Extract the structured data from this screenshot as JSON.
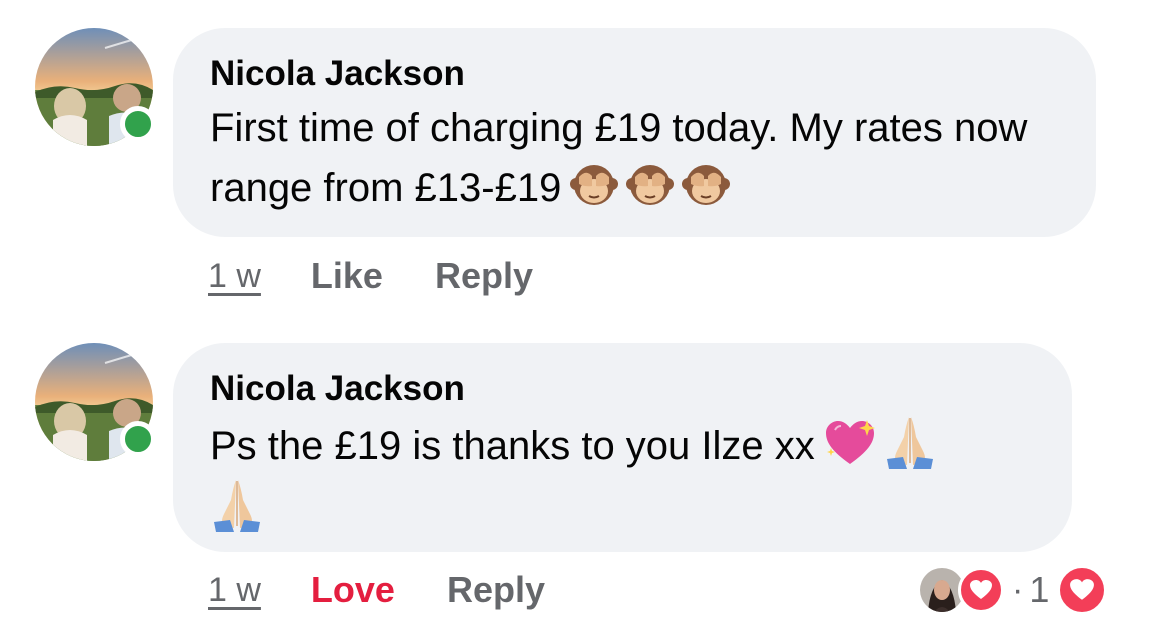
{
  "comments": [
    {
      "author": "Nicola Jackson",
      "text": "First time of charging £19 today. My rates now range from £13-£19",
      "emojis": [
        "see-no-evil-monkey",
        "see-no-evil-monkey",
        "see-no-evil-monkey"
      ],
      "time": "1 w",
      "actions": [
        "Like",
        "Reply"
      ],
      "online": true
    },
    {
      "author": "Nicola Jackson",
      "text": "Ps the £19 is thanks to you Ilze xx",
      "emojis": [
        "sparkling-heart",
        "folded-hands",
        "folded-hands"
      ],
      "time": "1 w",
      "actions": [
        "Love",
        "Reply"
      ],
      "online": true,
      "reactions": {
        "type": "love",
        "count": "1",
        "separator": "·"
      }
    }
  ],
  "colors": {
    "bubble": "#f0f2f5",
    "online": "#31a24c",
    "love": "#e41e3f",
    "heart_badge": "#f33e58",
    "meta": "#65676b"
  }
}
